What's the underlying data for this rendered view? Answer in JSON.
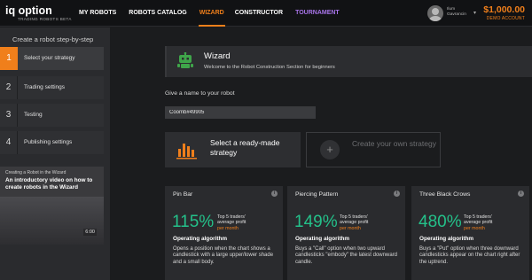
{
  "brand": {
    "logo_text_prefix": "iq option",
    "logo_tagline": "TRADING ROBOTS BETA"
  },
  "nav": {
    "items": [
      {
        "label": "MY ROBOTS",
        "active": false
      },
      {
        "label": "ROBOTS CATALOG",
        "active": false
      },
      {
        "label": "WIZARD",
        "active": true
      },
      {
        "label": "CONSTRUCTOR",
        "active": false
      },
      {
        "label": "TOURNAMENT",
        "active": false
      }
    ]
  },
  "user": {
    "name": "Ilum Gavrancin",
    "balance": "$1,000.00",
    "account_type": "DEMO ACCOUNT"
  },
  "sidebar": {
    "title": "Create a robot step-by-step",
    "steps": [
      {
        "num": "1",
        "label": "Select your strategy"
      },
      {
        "num": "2",
        "label": "Trading settings"
      },
      {
        "num": "3",
        "label": "Testing"
      },
      {
        "num": "4",
        "label": "Publishing settings"
      }
    ],
    "video": {
      "kicker": "Creating a Robot in the Wizard",
      "title": "An introductory video on how to create robots in the Wizard",
      "duration": "6:00"
    }
  },
  "wizard": {
    "title": "Wizard",
    "subtitle": "Welcome to the Robot Construction Section for beginners"
  },
  "robot_name": {
    "label": "Give a name to your robot",
    "value": "Coomb#49905"
  },
  "strategy_options": {
    "ready": "Select a ready-made strategy",
    "custom": "Create your own strategy"
  },
  "cards": [
    {
      "name": "Pin Bar",
      "pct": "115%",
      "meta_line1": "Top 5 traders'",
      "meta_line2": "average profit",
      "meta_line3": "per month",
      "algo_label": "Operating algorithm",
      "desc": "Opens a position when the chart shows a candlestick with a large upper/lower shade and a small body."
    },
    {
      "name": "Piercing Pattern",
      "pct": "149%",
      "meta_line1": "Top 5 traders'",
      "meta_line2": "average profit",
      "meta_line3": "per month",
      "algo_label": "Operating algorithm",
      "desc": "Buys a \"Call\" option when two upward candlesticks \"embody\" the latest downward candle."
    },
    {
      "name": "Three Black Crows",
      "pct": "480%",
      "meta_line1": "Top 5 traders'",
      "meta_line2": "average profit",
      "meta_line3": "per month",
      "algo_label": "Operating algorithm",
      "desc": "Buys a \"Put\" option when three downward candlesticks appear on the chart right after the uptrend."
    }
  ],
  "colors": {
    "accent": "#f07f1b",
    "profit_green": "#24c18a",
    "tournament_purple": "#a774e8",
    "robot_icon_green": "#3fa54a"
  },
  "icons": {
    "robot": "robot-icon",
    "bars": "bar-chart-icon",
    "plus": "plus-icon",
    "info": "info-icon",
    "caret": "chevron-down-icon"
  }
}
